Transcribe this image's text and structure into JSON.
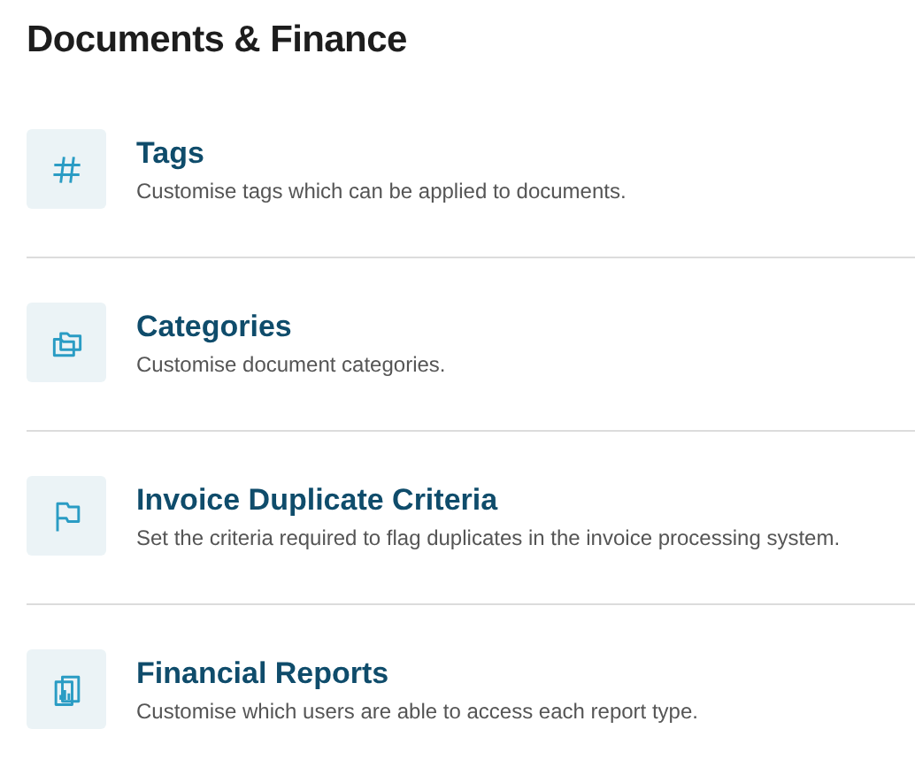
{
  "heading": "Documents & Finance",
  "items": [
    {
      "kind": "hash",
      "title": "Tags",
      "description": "Customise tags which can be applied to documents."
    },
    {
      "kind": "folders",
      "title": "Categories",
      "description": "Customise document categories."
    },
    {
      "kind": "flag",
      "title": "Invoice Duplicate Criteria",
      "description": "Set the criteria required to flag duplicates in the invoice processing system."
    },
    {
      "kind": "report",
      "title": "Financial Reports",
      "description": "Customise which users are able to access each report type."
    }
  ]
}
